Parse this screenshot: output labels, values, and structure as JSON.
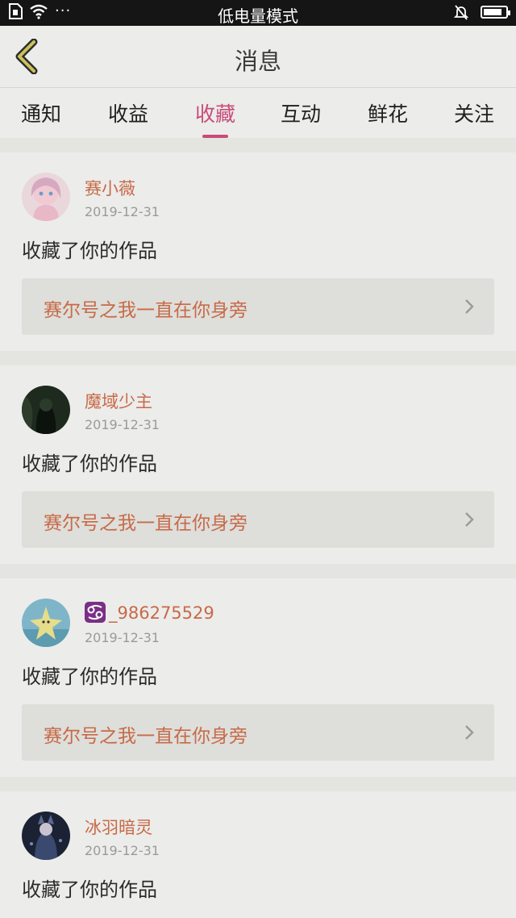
{
  "status_bar": {
    "title": "低电量模式",
    "dots": "···"
  },
  "header": {
    "title": "消息"
  },
  "tabs": [
    {
      "label": "通知"
    },
    {
      "label": "收益"
    },
    {
      "label": "收藏"
    },
    {
      "label": "互动"
    },
    {
      "label": "鲜花"
    },
    {
      "label": "关注"
    }
  ],
  "active_tab": "收藏",
  "colors": {
    "accent": "#c94b7a",
    "username": "#c76a48",
    "background": "#e4e4e1",
    "statusbar": "#151515"
  },
  "feed": [
    {
      "username": "赛小薇",
      "date": "2019-12-31",
      "action": "收藏了你的作品",
      "work_title": "赛尔号之我一直在你身旁",
      "avatar_icon": "anime-girl-avatar"
    },
    {
      "username": "魔域少主",
      "date": "2019-12-31",
      "action": "收藏了你的作品",
      "work_title": "赛尔号之我一直在你身旁",
      "avatar_icon": "dark-figure-avatar"
    },
    {
      "username": "_986275529",
      "username_icon": "cancer-zodiac-icon",
      "date": "2019-12-31",
      "action": "收藏了你的作品",
      "work_title": "赛尔号之我一直在你身旁",
      "avatar_icon": "star-creature-avatar"
    },
    {
      "username": "冰羽暗灵",
      "date": "2019-12-31",
      "action": "收藏了你的作品",
      "avatar_icon": "night-character-avatar"
    }
  ]
}
